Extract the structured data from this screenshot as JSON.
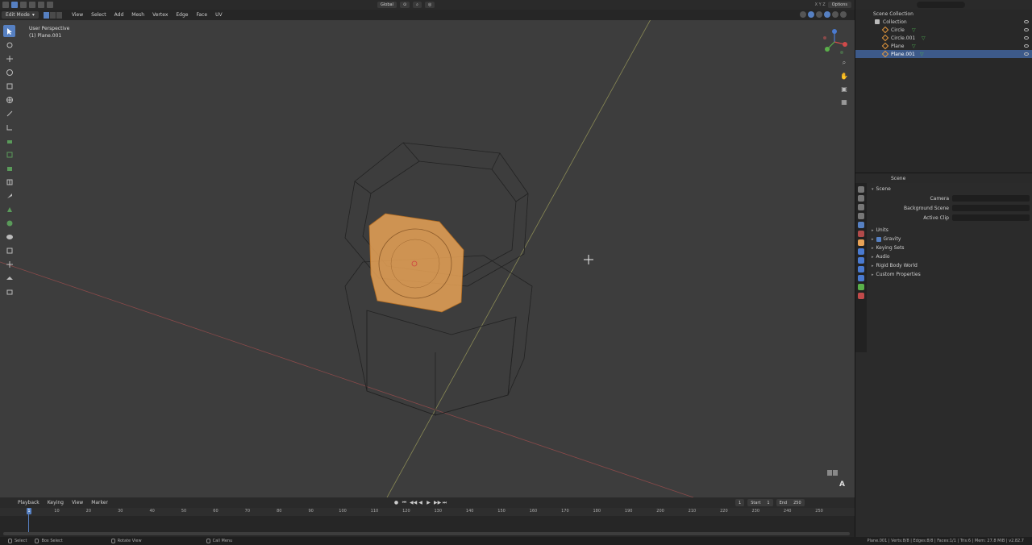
{
  "header": {
    "mode": "Edit Mode",
    "menus": [
      "View",
      "Select",
      "Add",
      "Mesh",
      "Vertex",
      "Edge",
      "Face",
      "UV"
    ],
    "orientation": "Global",
    "axes": "X Y Z",
    "options": "Options"
  },
  "viewport": {
    "line1": "User Perspective",
    "line2": "(1) Plane.001",
    "corner_label": "A"
  },
  "timeline": {
    "menus": [
      "Playback",
      "Keying",
      "View",
      "Marker"
    ],
    "current_frame": "1",
    "start_label": "Start",
    "start_value": "1",
    "end_label": "End",
    "end_value": "250",
    "ticks": [
      "1",
      "10",
      "20",
      "30",
      "40",
      "50",
      "60",
      "70",
      "80",
      "90",
      "100",
      "110",
      "120",
      "130",
      "140",
      "150",
      "160",
      "170",
      "180",
      "190",
      "200",
      "210",
      "220",
      "230",
      "240",
      "250"
    ]
  },
  "statusbar": {
    "select": "Select",
    "box_select": "Box Select",
    "rotate": "Rotate View",
    "call_menu": "Call Menu",
    "stats": "Plane.001 | Verts:8/8 | Edges:8/8 | Faces:1/1 | Tris:6 | Mem: 27.8 MiB | v2.82.7"
  },
  "outliner": {
    "root": "Scene Collection",
    "collection": "Collection",
    "items": [
      {
        "label": "Circle"
      },
      {
        "label": "Circle.001"
      },
      {
        "label": "Plane"
      },
      {
        "label": "Plane.001"
      }
    ]
  },
  "properties": {
    "title": "Scene",
    "section": "Scene",
    "fields": [
      "Camera",
      "Background Scene",
      "Active Clip"
    ],
    "sections": [
      "Units",
      "Gravity",
      "Keying Sets",
      "Audio",
      "Rigid Body World",
      "Custom Properties"
    ]
  },
  "colors": {
    "accent": "#5680c2",
    "selection_face": "#e8a256",
    "viewport_bg": "#3d3d3d"
  }
}
